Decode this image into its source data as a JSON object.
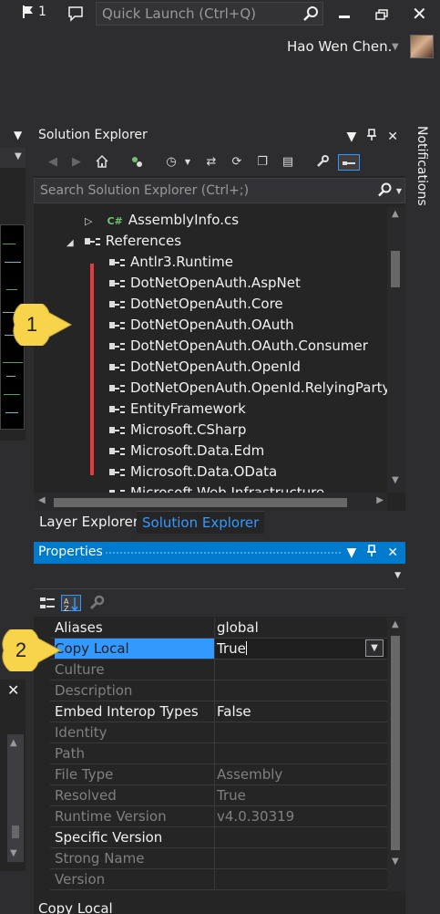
{
  "topbar": {
    "notification_count": "1",
    "quick_launch_placeholder": "Quick Launch (Ctrl+Q)",
    "user_name": "Hao Wen Chen."
  },
  "notifications_label": "Notifications",
  "solution_explorer": {
    "title": "Solution Explorer",
    "search_placeholder": "Search Solution Explorer (Ctrl+;)",
    "tree": {
      "file_item": "AssemblyInfo.cs",
      "references_label": "References",
      "references": [
        "Antlr3.Runtime",
        "DotNetOpenAuth.AspNet",
        "DotNetOpenAuth.Core",
        "DotNetOpenAuth.OAuth",
        "DotNetOpenAuth.OAuth.Consumer",
        "DotNetOpenAuth.OpenId",
        "DotNetOpenAuth.OpenId.RelyingParty",
        "EntityFramework",
        "Microsoft.CSharp",
        "Microsoft.Data.Edm",
        "Microsoft.Data.OData",
        "Microsoft.Web.Infrastructure"
      ]
    }
  },
  "tabs": {
    "layer_explorer": "Layer Explorer",
    "solution_explorer": "Solution Explorer"
  },
  "properties": {
    "title": "Properties",
    "rows": [
      {
        "name": "Aliases",
        "value": "global"
      },
      {
        "name": "Copy Local",
        "value": "True"
      },
      {
        "name": "Culture",
        "value": ""
      },
      {
        "name": "Description",
        "value": ""
      },
      {
        "name": "Embed Interop Types",
        "value": "False"
      },
      {
        "name": "Identity",
        "value": ""
      },
      {
        "name": "Path",
        "value": ""
      },
      {
        "name": "File Type",
        "value": "Assembly"
      },
      {
        "name": "Resolved",
        "value": "True"
      },
      {
        "name": "Runtime Version",
        "value": "v4.0.30319"
      },
      {
        "name": "Specific Version",
        "value": ""
      },
      {
        "name": "Strong Name",
        "value": ""
      },
      {
        "name": "Version",
        "value": ""
      }
    ],
    "description_name": "Copy Local"
  },
  "callouts": {
    "one": "1",
    "two": "2"
  },
  "colors": {
    "accent": "#007acc",
    "selection": "#3399ff",
    "callout": "#f7d44a",
    "marker": "#e53b3b"
  }
}
